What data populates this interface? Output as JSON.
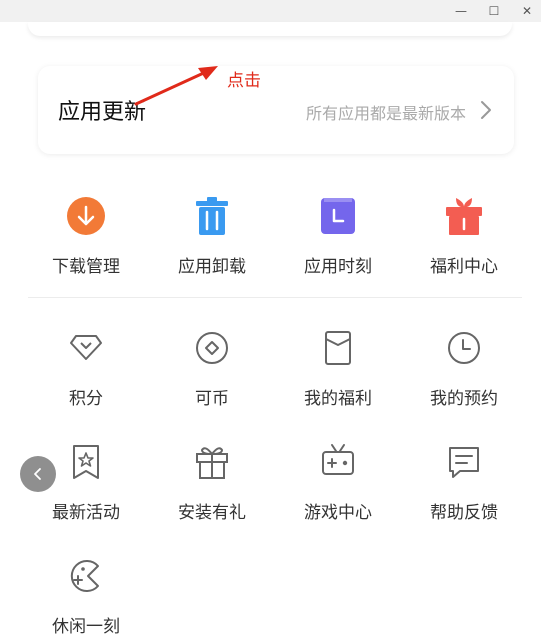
{
  "window": {
    "minimize_glyph": "—",
    "maximize_glyph": "☐",
    "close_glyph": "✕"
  },
  "update": {
    "title": "应用更新",
    "status": "所有应用都是最新版本",
    "chevron_icon": "chevron-right-icon"
  },
  "annotation": {
    "text": "点击",
    "color": "#e02a1a"
  },
  "primary_grid": [
    {
      "label": "下载管理",
      "icon": "download-icon",
      "color": "#f27a37"
    },
    {
      "label": "应用卸载",
      "icon": "trash-icon",
      "color": "#3a9af0"
    },
    {
      "label": "应用时刻",
      "icon": "clock-square-icon",
      "color": "#7466ec"
    },
    {
      "label": "福利中心",
      "icon": "gift-icon",
      "color": "#f35d52"
    }
  ],
  "secondary_grid": [
    {
      "label": "积分",
      "icon": "diamond-icon"
    },
    {
      "label": "可币",
      "icon": "coin-icon"
    },
    {
      "label": "我的福利",
      "icon": "bookmark-icon"
    },
    {
      "label": "我的预约",
      "icon": "clock-icon"
    },
    {
      "label": "最新活动",
      "icon": "star-bookmark-icon"
    },
    {
      "label": "安装有礼",
      "icon": "gift-outline-icon"
    },
    {
      "label": "游戏中心",
      "icon": "gamepad-icon"
    },
    {
      "label": "帮助反馈",
      "icon": "message-icon"
    },
    {
      "label": "休闲一刻",
      "icon": "pacman-icon"
    }
  ]
}
